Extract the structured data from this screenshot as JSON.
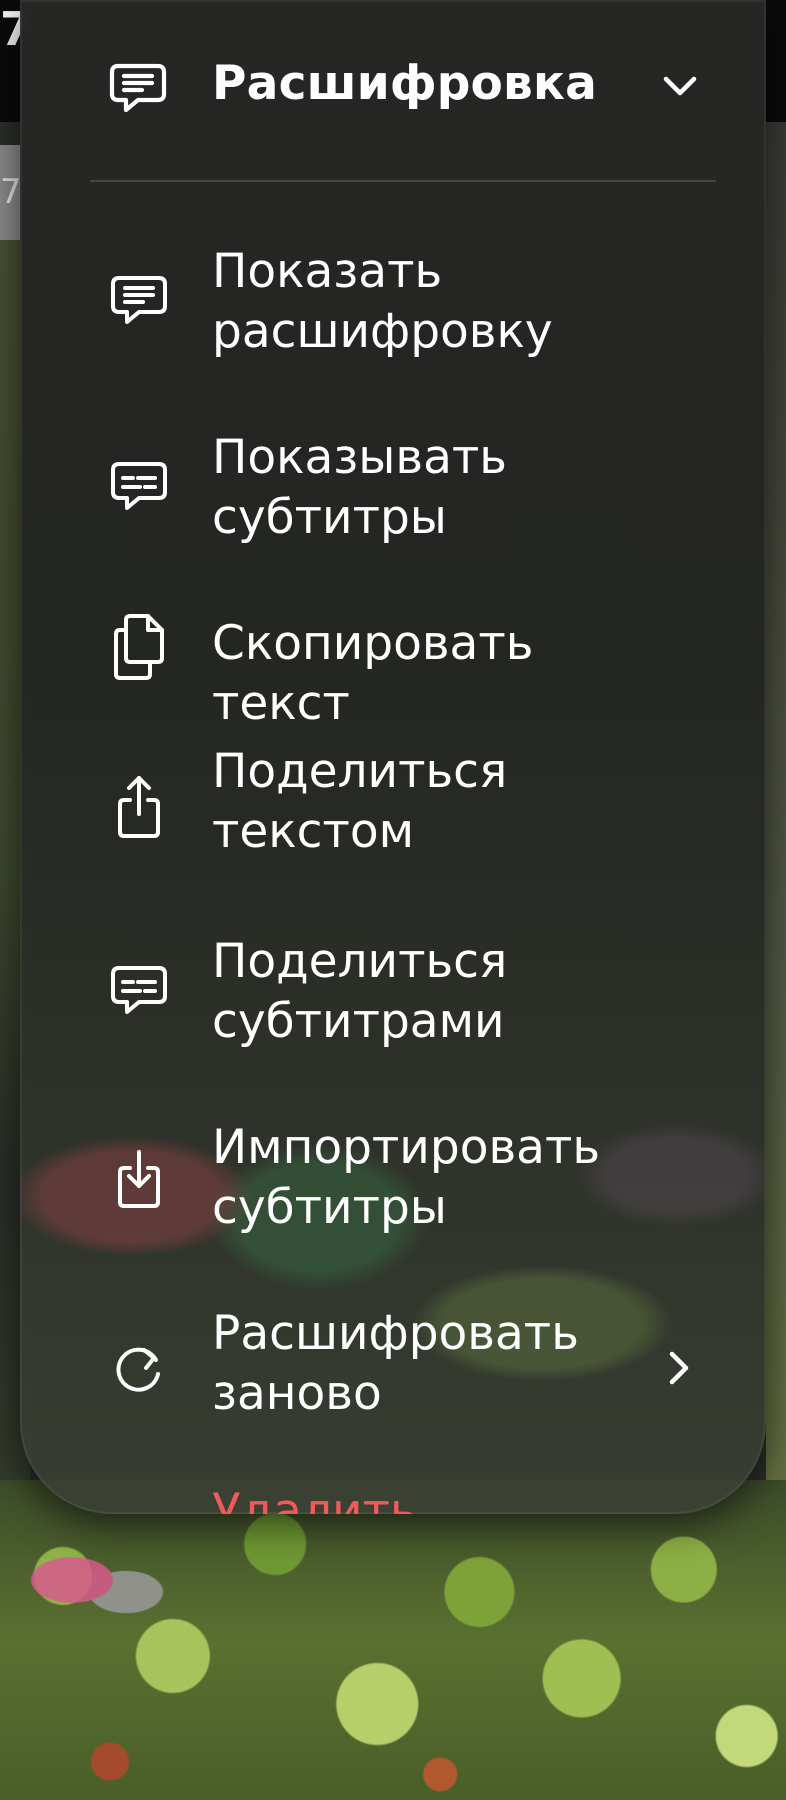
{
  "background": {
    "top_left_char": "7",
    "strip_char": "7"
  },
  "menu": {
    "header": {
      "icon": "transcript-bubble-icon",
      "title": "Расшифровка",
      "expand_icon": "chevron-down-icon"
    },
    "items": [
      {
        "label": "Показать\nрасшифровку",
        "icon": "transcript-bubble-icon"
      },
      {
        "label": "Показывать\nсубтитры",
        "icon": "subtitles-bubble-icon"
      },
      {
        "label": "Скопировать текст",
        "icon": "copy-documents-icon"
      },
      {
        "label": "Поделиться\nтекстом",
        "icon": "share-icon"
      },
      {
        "label": "Поделиться\nсубтитрами",
        "icon": "subtitles-bubble-icon"
      },
      {
        "label": "Импортировать\nсубтитры",
        "icon": "import-download-icon"
      },
      {
        "label": "Расшифровать\nзаново",
        "icon": "refresh-icon",
        "submenu_icon": "chevron-right-icon"
      }
    ],
    "partial_item": {
      "label": "Удалить",
      "color": "#f05a5a"
    }
  }
}
